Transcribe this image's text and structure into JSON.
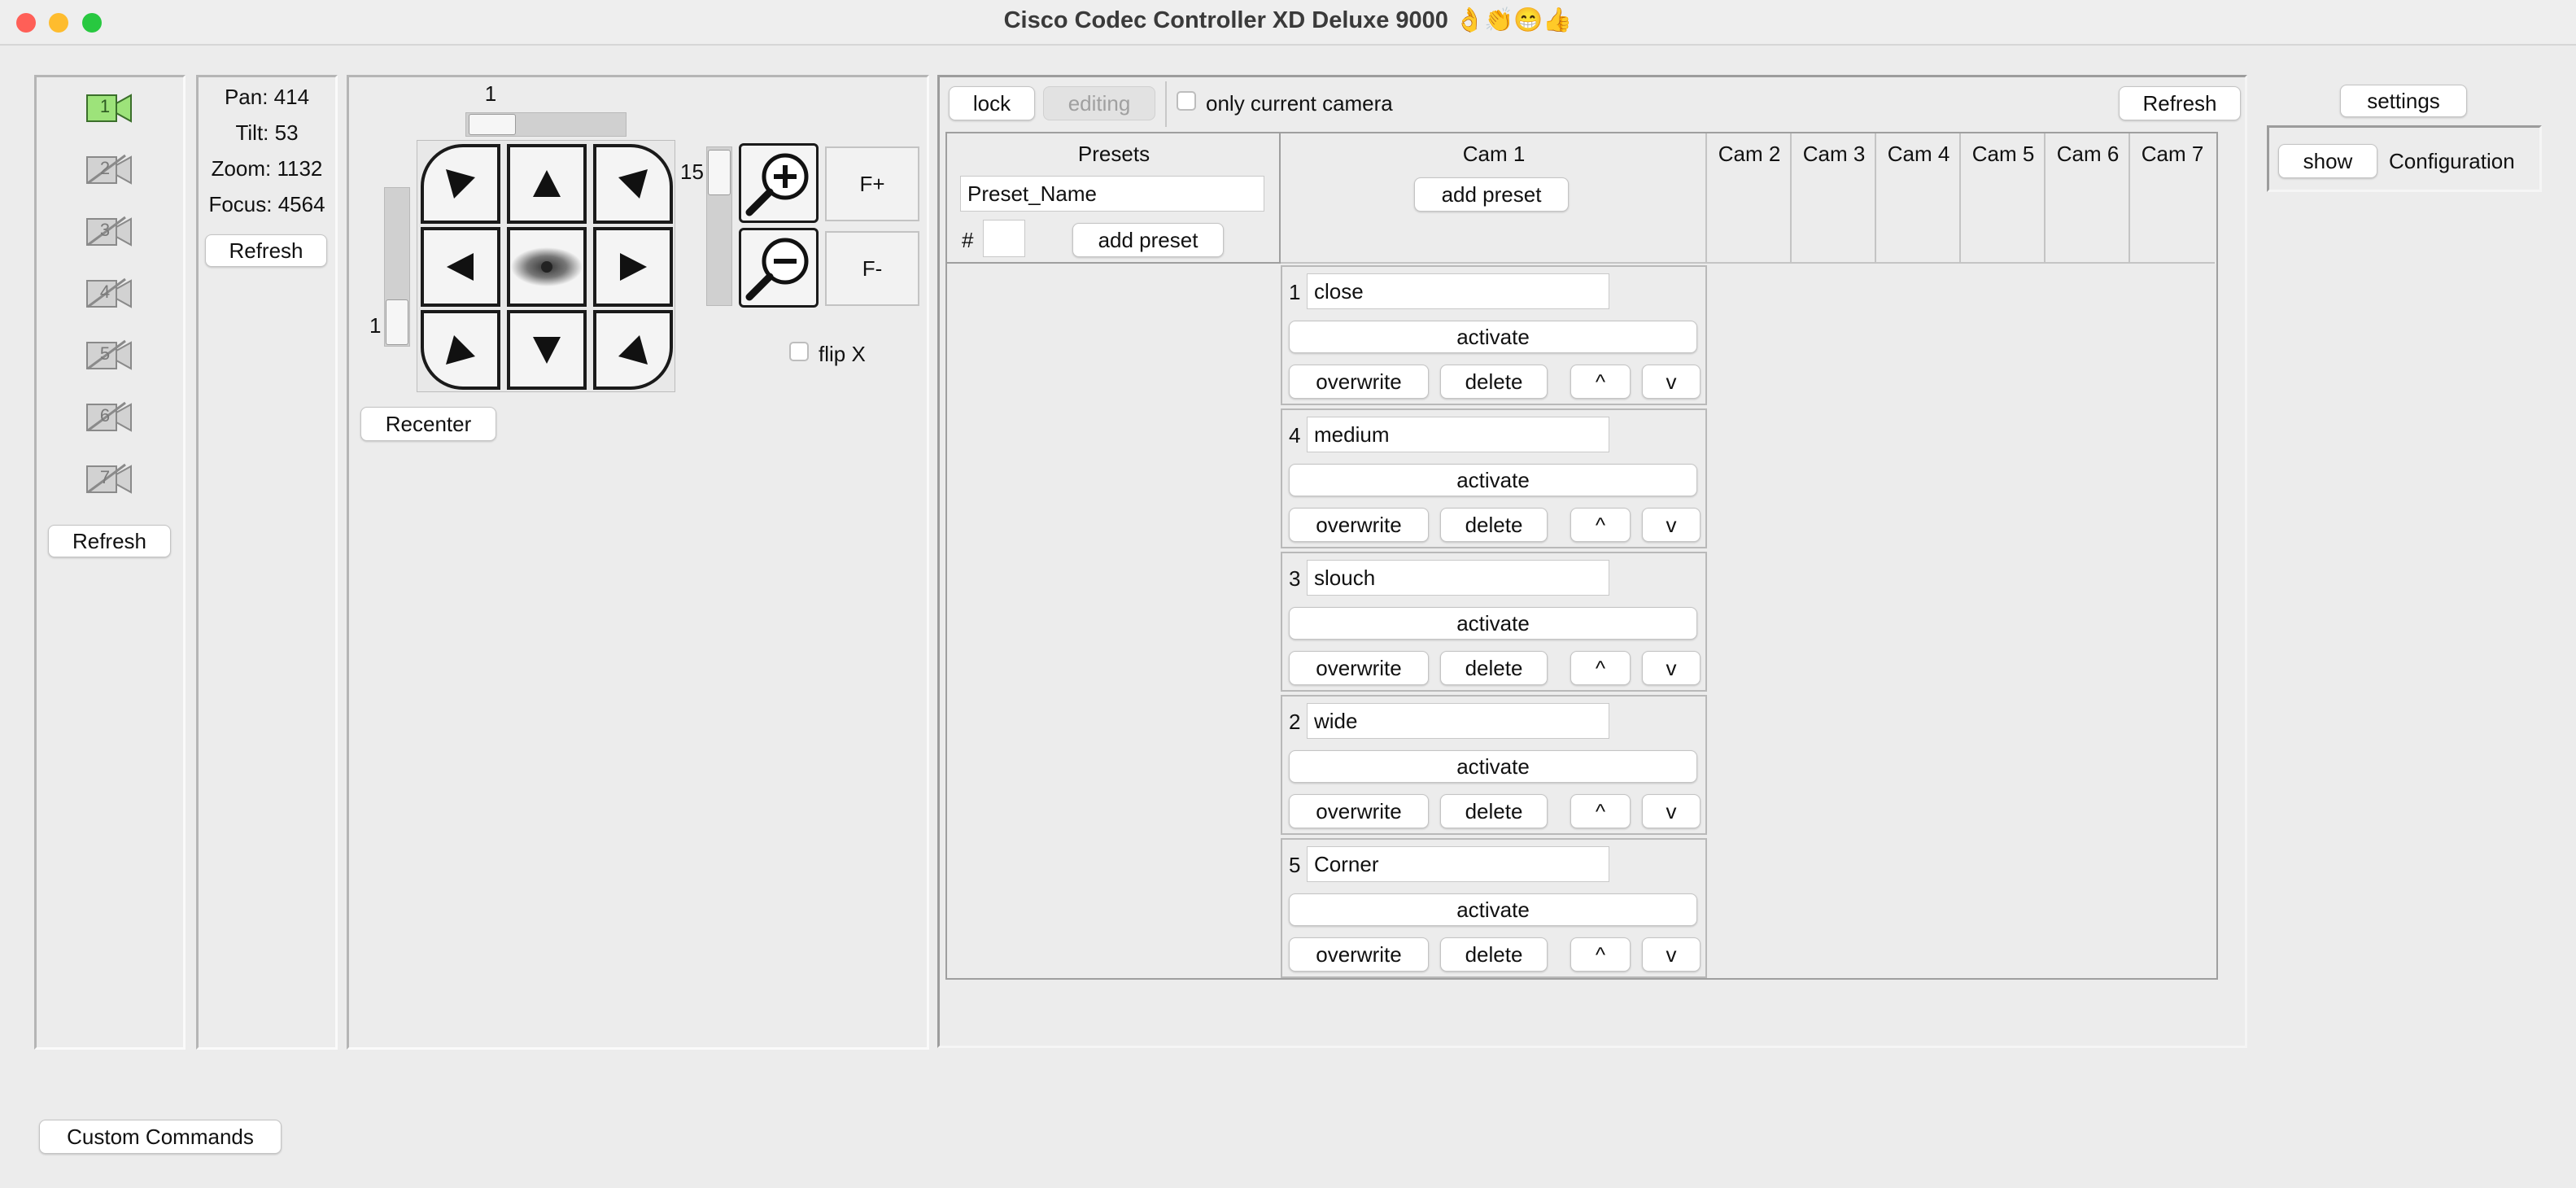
{
  "window": {
    "title": "Cisco Codec Controller XD Deluxe 9000 👌👏😁👍",
    "traffic_lights": {
      "close": "#ff5f57",
      "minimize": "#febc2e",
      "zoom": "#28c840"
    }
  },
  "cameras": {
    "items": [
      {
        "number": "1",
        "active": true
      },
      {
        "number": "2",
        "active": false
      },
      {
        "number": "3",
        "active": false
      },
      {
        "number": "4",
        "active": false
      },
      {
        "number": "5",
        "active": false
      },
      {
        "number": "6",
        "active": false
      },
      {
        "number": "7",
        "active": false
      }
    ],
    "refresh_label": "Refresh",
    "active_color": "#9de37a"
  },
  "status": {
    "pan": "Pan: 414",
    "tilt": "Tilt: 53",
    "zoom": "Zoom: 1132",
    "focus": "Focus: 4564",
    "refresh_label": "Refresh"
  },
  "ptz": {
    "pan_speed_value": "1",
    "tilt_speed_value": "1",
    "zoom_speed_value": "15",
    "recenter_label": "Recenter",
    "focus_plus_label": "F+",
    "focus_minus_label": "F-",
    "flip_x_label": "flip X"
  },
  "presets_panel": {
    "lock_label": "lock",
    "editing_label": "editing",
    "only_current_camera_label": "only current camera",
    "refresh_label": "Refresh",
    "presets_header": "Presets",
    "preset_name_value": "Preset_Name",
    "hash_label": "#",
    "add_preset_label": "add preset",
    "cam_columns": [
      "Cam 1",
      "Cam 2",
      "Cam 3",
      "Cam 4",
      "Cam 5",
      "Cam 6",
      "Cam 7"
    ],
    "cam1_add_preset_label": "add preset",
    "presets": [
      {
        "number": "1",
        "name": "close"
      },
      {
        "number": "4",
        "name": "medium"
      },
      {
        "number": "3",
        "name": "slouch"
      },
      {
        "number": "2",
        "name": "wide"
      },
      {
        "number": "5",
        "name": "Corner"
      }
    ],
    "buttons": {
      "activate": "activate",
      "overwrite": "overwrite",
      "delete": "delete",
      "up": "^",
      "down": "v"
    }
  },
  "settings": {
    "settings_label": "settings",
    "show_label": "show",
    "configuration_label": "Configuration"
  },
  "footer": {
    "custom_commands_label": "Custom Commands"
  }
}
